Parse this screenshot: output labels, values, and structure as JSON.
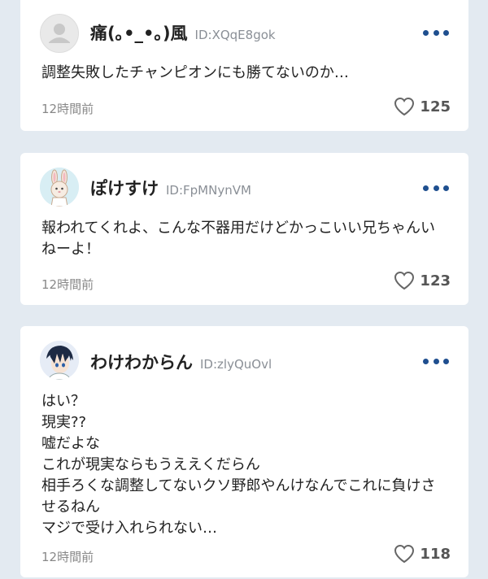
{
  "comments": [
    {
      "username": "痛(｡•_•｡)風",
      "user_id": "ID:XQqE8gok",
      "avatar": "default-user-icon",
      "lines": [
        "調整失敗したチャンピオンにも勝てないのか…"
      ],
      "time": "12時間前",
      "likes": "125"
    },
    {
      "username": "ぽけすけ",
      "user_id": "ID:FpMNynVM",
      "avatar": "bunny-avatar",
      "lines": [
        "報われてくれよ、こんな不器用だけどかっこいい兄ちゃんい",
        "ねーよ！"
      ],
      "time": "12時間前",
      "likes": "123"
    },
    {
      "username": "わけわからん",
      "user_id": "ID:zlyQuOvl",
      "avatar": "anime-character-avatar",
      "lines": [
        "はい？",
        "現実??",
        "嘘だよな",
        "これが現実ならもうええくだらん",
        "相手ろくな調整してないクソ野郎やんけなんでこれに負けさ",
        "せるねん",
        "マジで受け入れられない…"
      ],
      "time": "12時間前",
      "likes": "118"
    }
  ],
  "colors": {
    "background": "#e3eaf1",
    "card": "#ffffff",
    "menu_dots": "#1f4f8f",
    "muted_text": "#888888"
  }
}
